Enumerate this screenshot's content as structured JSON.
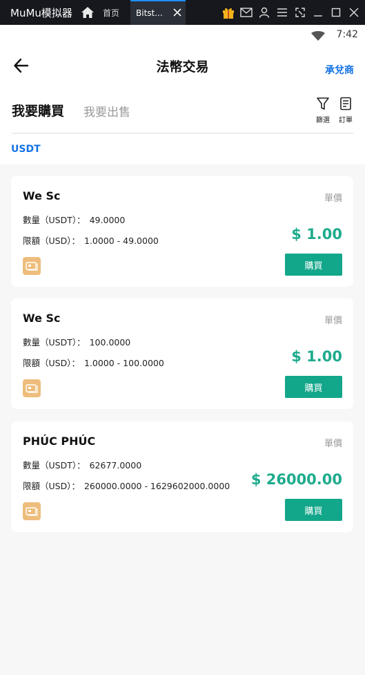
{
  "emulator": {
    "app_title": "MuMu模拟器",
    "home_tab": "首页",
    "active_tab": "Bitst..."
  },
  "status": {
    "time": "7:42"
  },
  "header": {
    "title": "法幣交易",
    "merchant_link": "承兌商"
  },
  "tabs": {
    "buy": "我要購買",
    "sell": "我要出售",
    "filter": "篩選",
    "orders": "訂單"
  },
  "coin": "USDT",
  "listings": [
    {
      "trader": "We Sc",
      "unit_label": "單價",
      "qty_label": "數量（USDT）：",
      "qty_value": "49.0000",
      "limit_label": "限額（USD）：",
      "limit_value": "1.0000 - 49.0000",
      "price": "$ 1.00",
      "button": "購買"
    },
    {
      "trader": "We Sc",
      "unit_label": "單價",
      "qty_label": "數量（USDT）：",
      "qty_value": "100.0000",
      "limit_label": "限額（USD）：",
      "limit_value": "1.0000 - 100.0000",
      "price": "$ 1.00",
      "button": "購買"
    },
    {
      "trader": "PHÚC PHÚC",
      "unit_label": "單價",
      "qty_label": "數量（USDT）：",
      "qty_value": "62677.0000",
      "limit_label": "限額（USD）：",
      "limit_value": "260000.0000 - 1629602000.0000",
      "price": "$ 26000.00",
      "button": "購買"
    }
  ],
  "colors": {
    "accent_blue": "#1473e6",
    "price_green": "#1eab8d",
    "button_green": "#12a68a",
    "payment_icon": "#eebd7c"
  },
  "icons": {
    "back": "arrow-left-icon",
    "filter": "funnel-icon",
    "orders": "document-icon",
    "payment": "bank-card-icon"
  }
}
